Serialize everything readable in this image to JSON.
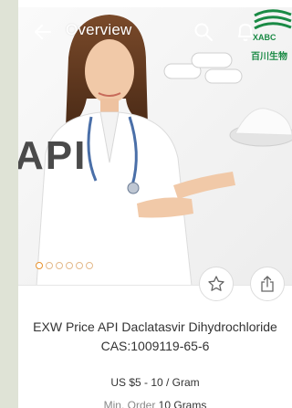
{
  "header": {
    "title": "Overview"
  },
  "logo": {
    "mark": "XABC",
    "name": "百川生物"
  },
  "hero": {
    "overlay_text": "API",
    "slide_count": 6,
    "active_slide": 1
  },
  "product": {
    "name": "EXW Price API Daclatasvir Dihydrochloride CAS:1009119-65-6",
    "price": "US $5 - 10 / Gram",
    "moq_label": "Min. Order",
    "moq_value": "10 Grams"
  },
  "colors": {
    "accent": "#e8922c",
    "logo_green": "#1a8a45"
  }
}
